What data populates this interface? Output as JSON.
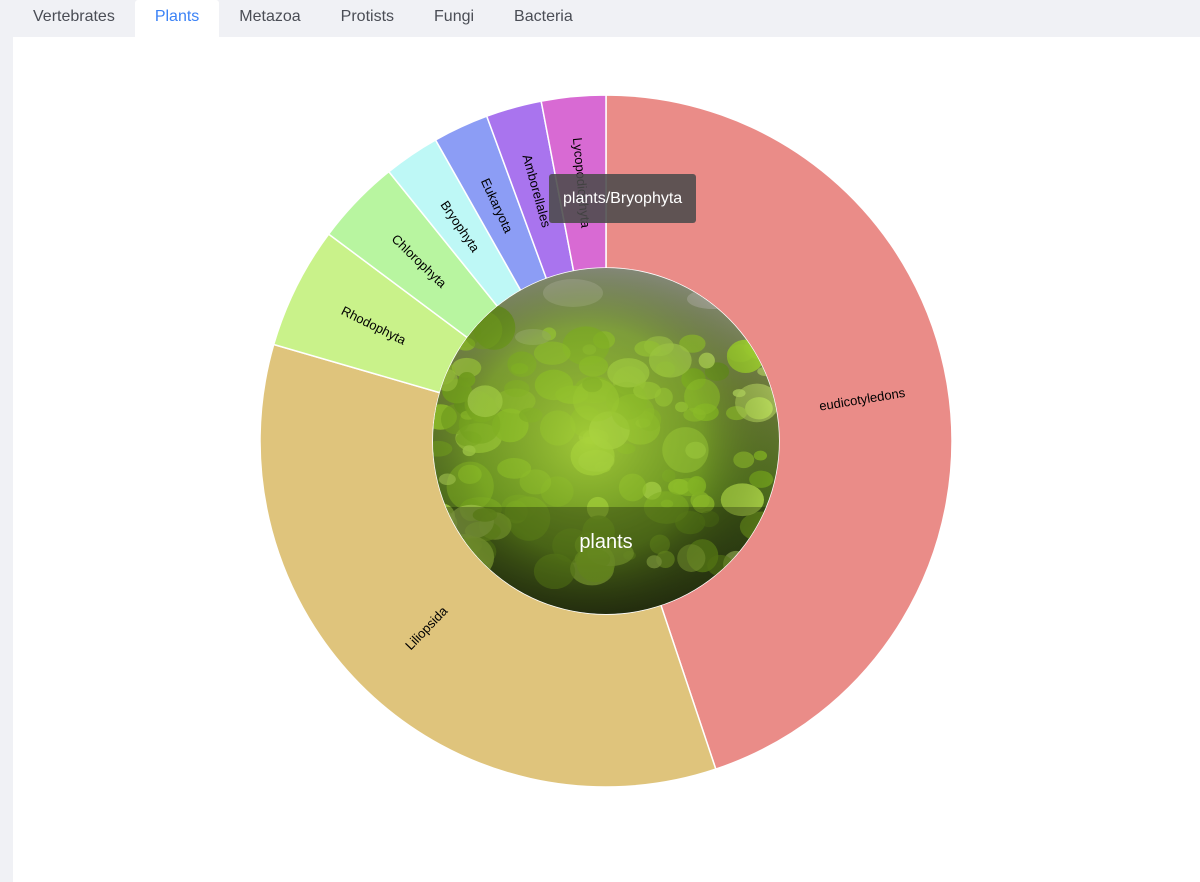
{
  "tabs": [
    {
      "label": "Vertebrates",
      "active": false
    },
    {
      "label": "Plants",
      "active": true
    },
    {
      "label": "Metazoa",
      "active": false
    },
    {
      "label": "Protists",
      "active": false
    },
    {
      "label": "Fungi",
      "active": false
    },
    {
      "label": "Bacteria",
      "active": false
    }
  ],
  "tooltip": {
    "text": "plants/Bryophyta"
  },
  "chart_data": {
    "type": "sunburst",
    "center": {
      "label": "plants",
      "image": "moss-photo"
    },
    "segments": [
      {
        "name": "eudicotyledons",
        "share": 0.4486,
        "color": "#ea8c88"
      },
      {
        "name": "Liliopsida",
        "share": 0.3464,
        "color": "#dfc47c"
      },
      {
        "name": "Rhodophyta",
        "share": 0.057,
        "color": "#c9f28a"
      },
      {
        "name": "Chlorophyta",
        "share": 0.04,
        "color": "#b8f5a0"
      },
      {
        "name": "Bryophyta",
        "share": 0.026,
        "color": "#bef8f6"
      },
      {
        "name": "Eukaryota",
        "share": 0.026,
        "color": "#8c9df5"
      },
      {
        "name": "Amborellales",
        "share": 0.026,
        "color": "#a974ee"
      },
      {
        "name": "Lycopodiophyta",
        "share": 0.03,
        "color": "#d86ad3"
      }
    ]
  }
}
